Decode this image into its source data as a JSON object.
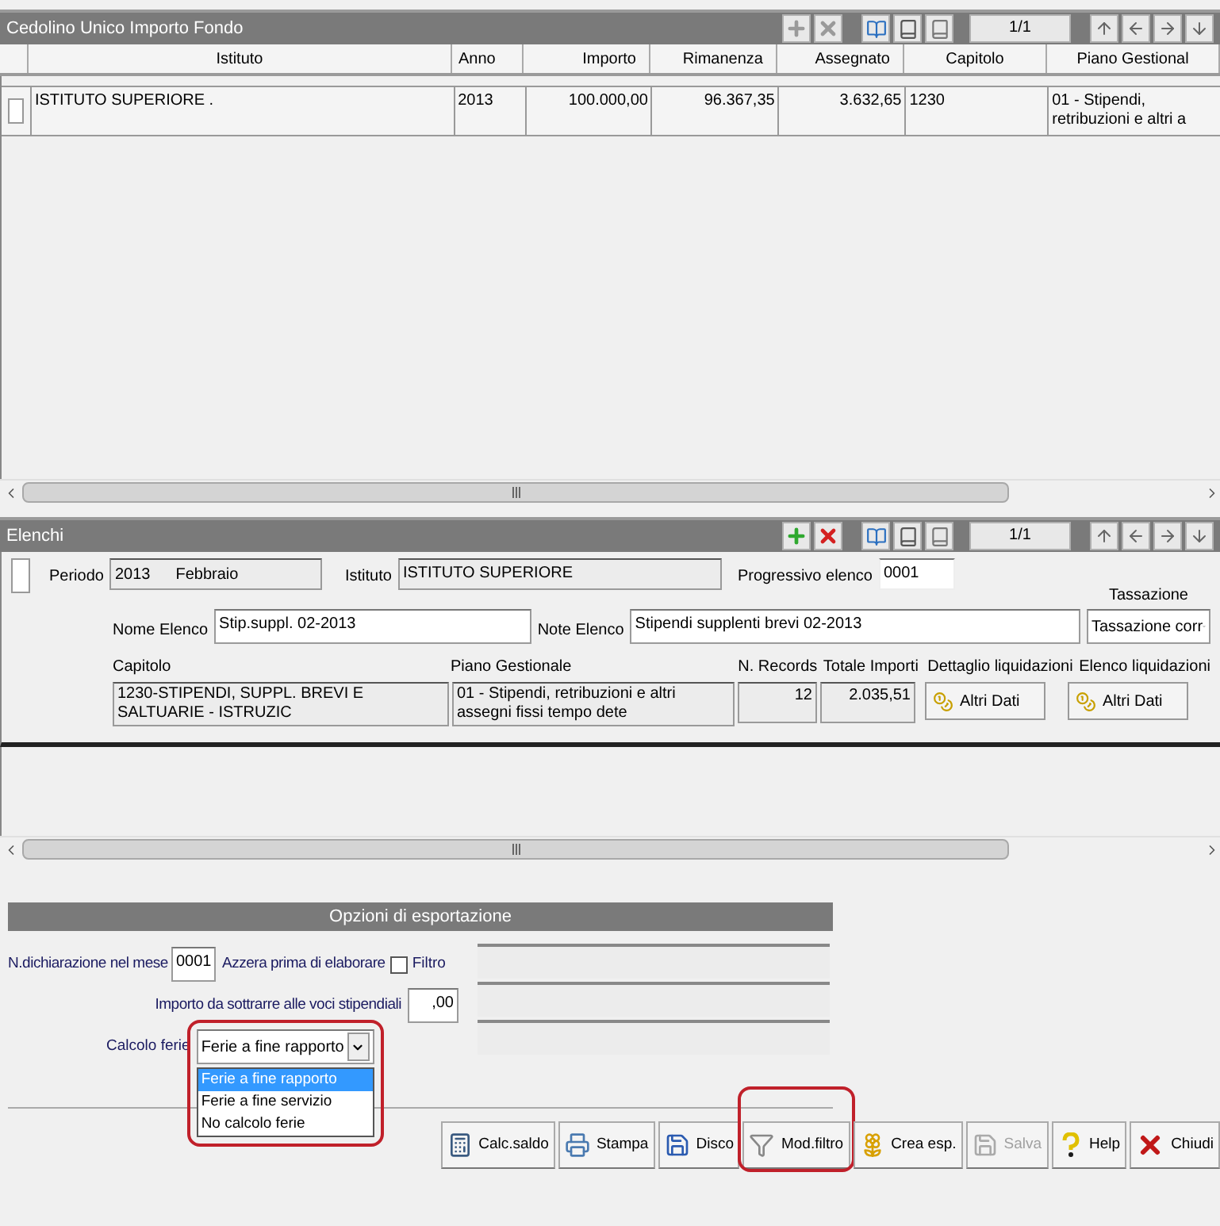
{
  "fondo": {
    "title": "Cedolino Unico Importo Fondo",
    "edit_enabled": false,
    "page": "1/1",
    "columns": [
      "Istituto",
      "Anno",
      "Importo",
      "Rimanenza",
      "Assegnato",
      "Capitolo",
      "Piano Gestional"
    ],
    "rows": [
      {
        "selected": false,
        "cells": [
          "ISTITUTO SUPERIORE .",
          "2013",
          "100.000,00",
          "96.367,35",
          "3.632,65",
          "1230",
          "01 - Stipendi, retribuzioni e altri a"
        ]
      }
    ]
  },
  "elenchi": {
    "title": "Elenchi",
    "edit_enabled": true,
    "page": "1/1",
    "periodo_label": "Periodo",
    "anno": "2013",
    "mese": "Febbraio",
    "istituto_label": "Istituto",
    "istituto": "ISTITUTO SUPERIORE",
    "progressivo_label": "Progressivo elenco",
    "progressivo": "0001",
    "tassazione_label": "Tassazione",
    "tassazione": "Tassazione corr",
    "nome_label": "Nome Elenco",
    "nome": "Stip.suppl. 02-2013",
    "note_label": "Note Elenco",
    "note": "Stipendi supplenti brevi 02-2013",
    "columns": [
      "Capitolo",
      "Piano Gestionale",
      "N. Records",
      "Totale Importi",
      "Dettaglio liquidazioni",
      "Elenco liquidazioni"
    ],
    "row": {
      "capitolo": "1230-STIPENDI, SUPPL. BREVI E SALTUARIE - ISTRUZIC",
      "piano": "01 - Stipendi, retribuzioni e altri assegni fissi tempo dete",
      "records": "12",
      "totale": "2.035,51",
      "dettaglio_button": "Altri Dati",
      "elenco_button": "Altri Dati"
    }
  },
  "export": {
    "title": "Opzioni di esportazione",
    "dichiarazione_label": "N.dichiarazione nel mese",
    "dichiarazione": "0001",
    "azzera_label": "Azzera prima di elaborare",
    "azzera_checked": false,
    "filtro_label": "Filtro",
    "importo_label": "Importo da sottrarre alle voci stipendiali",
    "importo": ",00",
    "ferie_label": "Calcolo ferie",
    "ferie": "Ferie a fine rapporto",
    "ferie_options": [
      {
        "label": "Ferie a fine rapporto",
        "selected": true
      },
      {
        "label": "Ferie a fine servizio",
        "selected": false
      },
      {
        "label": "No calcolo ferie",
        "selected": false
      }
    ]
  },
  "buttons": [
    {
      "kind": "calc",
      "label": "Calc.saldo",
      "disabled": false
    },
    {
      "kind": "print",
      "label": "Stampa",
      "disabled": false
    },
    {
      "kind": "disk",
      "label": "Disco",
      "disabled": false
    },
    {
      "kind": "filter",
      "label": "Mod.filtro",
      "disabled": false
    },
    {
      "kind": "create",
      "label": "Crea esp.",
      "disabled": false
    },
    {
      "kind": "save",
      "label": "Salva",
      "disabled": true
    },
    {
      "kind": "help",
      "label": "Help",
      "disabled": false
    },
    {
      "kind": "close",
      "label": "Chiudi",
      "disabled": false
    }
  ]
}
